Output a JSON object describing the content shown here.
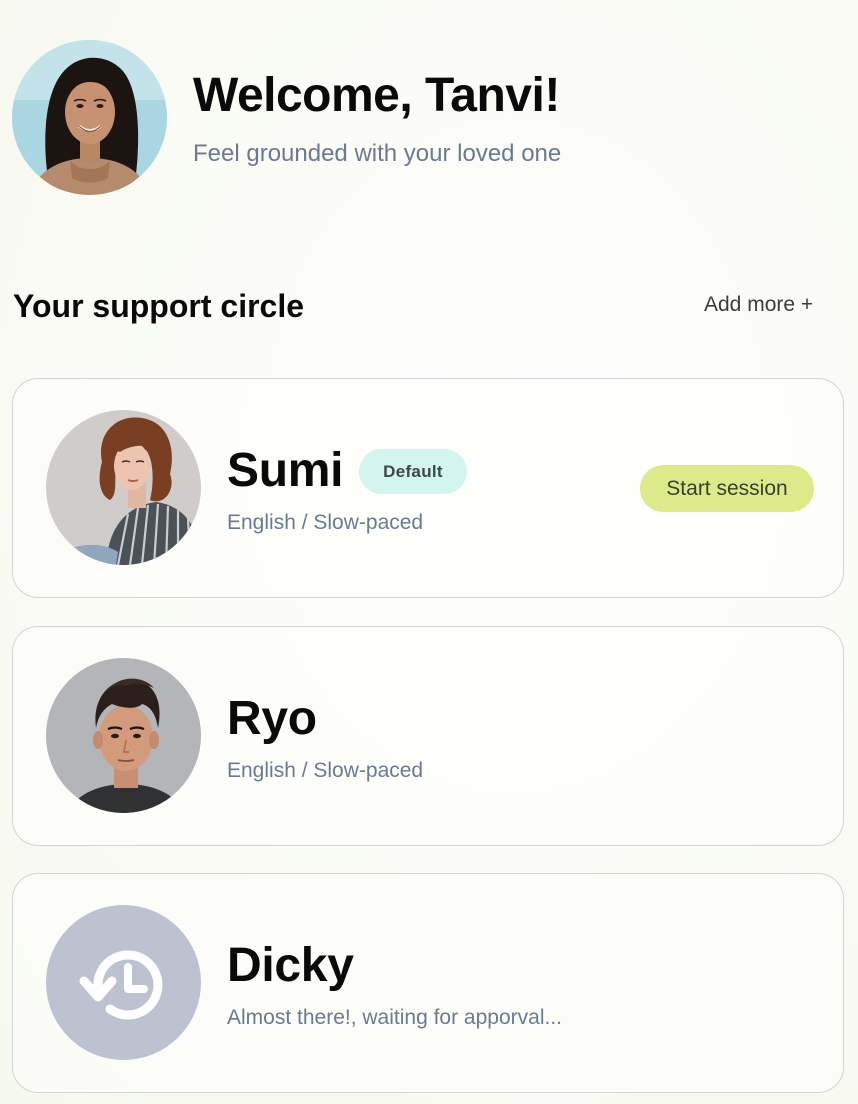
{
  "header": {
    "title": "Welcome, Tanvi!",
    "subtitle": "Feel grounded with your loved one"
  },
  "support": {
    "title": "Your support circle",
    "add_more_label": "Add more +",
    "members": [
      {
        "name": "Sumi",
        "badge": "Default",
        "detail": "English / Slow-paced",
        "action_label": "Start session",
        "avatar": "photo"
      },
      {
        "name": "Ryo",
        "detail": "English / Slow-paced",
        "avatar": "photo"
      },
      {
        "name": "Dicky",
        "detail": "Almost there!, waiting for apporval...",
        "avatar": "pending-clock-icon"
      }
    ]
  },
  "colors": {
    "badge_bg": "#d4f4f0",
    "action_bg": "#dcea8a",
    "subtext": "#6b7a90",
    "pending_avatar_bg": "#bcc2d0",
    "card_border": "#d2d4d6"
  }
}
